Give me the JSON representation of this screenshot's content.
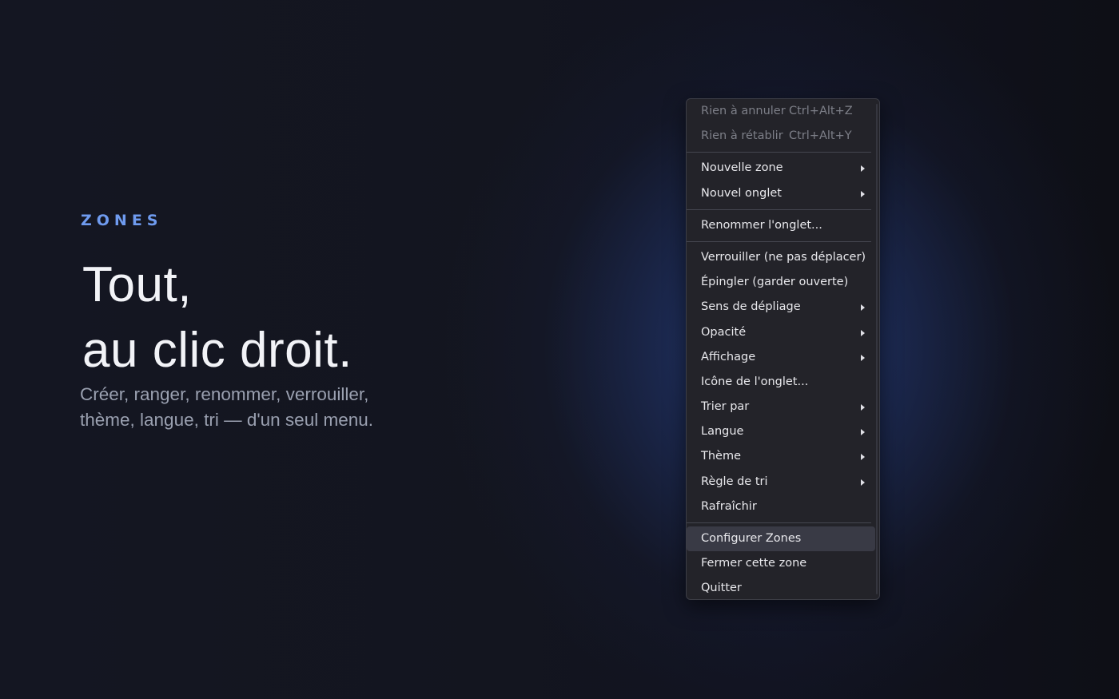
{
  "hero": {
    "eyebrow": "ZONES",
    "headline_line1": "Tout,",
    "headline_line2": "au clic droit.",
    "subtitle_line1": "Créer, ranger, renommer, verrouiller,",
    "subtitle_line2": "thème, langue, tri — d'un seul menu."
  },
  "menu": {
    "undo": {
      "label": "Rien à annuler",
      "shortcut": "Ctrl+Alt+Z"
    },
    "redo": {
      "label": "Rien à rétablir",
      "shortcut": "Ctrl+Alt+Y"
    },
    "new_zone": "Nouvelle zone",
    "new_tab": "Nouvel onglet",
    "rename_tab": "Renommer l'onglet...",
    "lock": "Verrouiller (ne pas déplacer)",
    "pin": "Épingler (garder ouverte)",
    "unfold_direction": "Sens de dépliage",
    "opacity": "Opacité",
    "display": "Affichage",
    "tab_icon": "Icône de l'onglet...",
    "sort_by": "Trier par",
    "language": "Langue",
    "theme": "Thème",
    "sort_rule": "Règle de tri",
    "refresh": "Rafraîchir",
    "configure": "Configurer Zones",
    "close_zone": "Fermer cette zone",
    "quit": "Quitter"
  },
  "colors": {
    "accent": "#6f9bef",
    "menu_bg": "#232329",
    "menu_highlight": "#393a45",
    "text": "#e8e8ec",
    "disabled_text": "#7d7f88"
  }
}
